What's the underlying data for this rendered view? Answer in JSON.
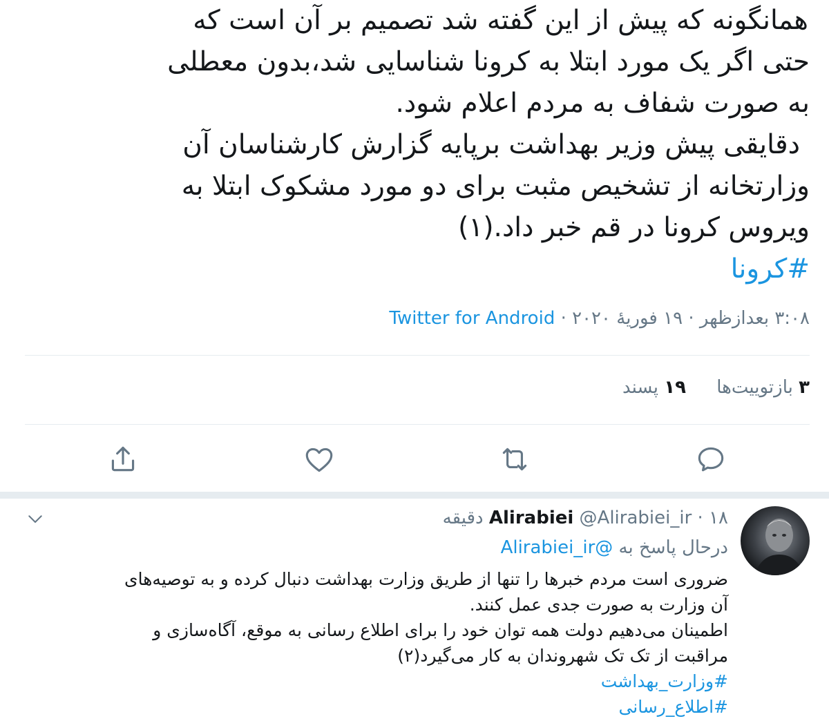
{
  "tweet": {
    "lines": [
      "همانگونه که پیش از این گفته شد تصمیم بر آن است که",
      "حتی اگر یک مورد ابتلا به کرونا شناسایی شد،بدون معطلی",
      "به صورت شفاف به مردم اعلام شود.",
      "دقایقی پیش وزیر بهداشت برپایه گزارش کارشناسان آن",
      "وزارتخانه از تشخیص مثبت برای دو مورد مشکوک ابتلا به",
      "ویروس کرونا در قم خبر داد.(۱)"
    ],
    "hashtag": "#کرونا",
    "time": "۳:۰۸ بعدازظهر",
    "date": "۱۹ فوریهٔ ۲۰۲۰",
    "source": "Twitter for Android",
    "separator": "·"
  },
  "stats": {
    "retweets_count": "۳",
    "retweets_label": "بازتوییت‌ها",
    "likes_count": "۱۹",
    "likes_label": "پسند"
  },
  "actions": {
    "icons": [
      "reply-icon",
      "retweet-icon",
      "like-icon",
      "share-icon"
    ]
  },
  "reply": {
    "name": "Alirabiei",
    "handle": "@Alirabiei_ir",
    "time": "۱۸ دقیقه",
    "separator": "·",
    "replying_prefix": "درحال پاسخ به",
    "replying_handle": "@Alirabiei_ir",
    "lines": [
      "ضروری است مردم خبرها را تنها از طریق وزارت بهداشت دنبال کرده و به توصیه‌های",
      "آن وزارت به صورت جدی عمل کنند.",
      "اطمینان می‌دهیم دولت همه توان خود را برای اطلاع رسانی به موقع، آگاه‌سازی و",
      "مراقبت از تک تک شهروندان به کار می‌گیرد(۲)"
    ],
    "hashtags": [
      "#وزارت_بهداشت",
      "#اطلاع_رسانی"
    ]
  },
  "colors": {
    "link": "#1b95e0",
    "muted": "#657786",
    "text": "#14171a",
    "divider": "#e6ecf0"
  }
}
